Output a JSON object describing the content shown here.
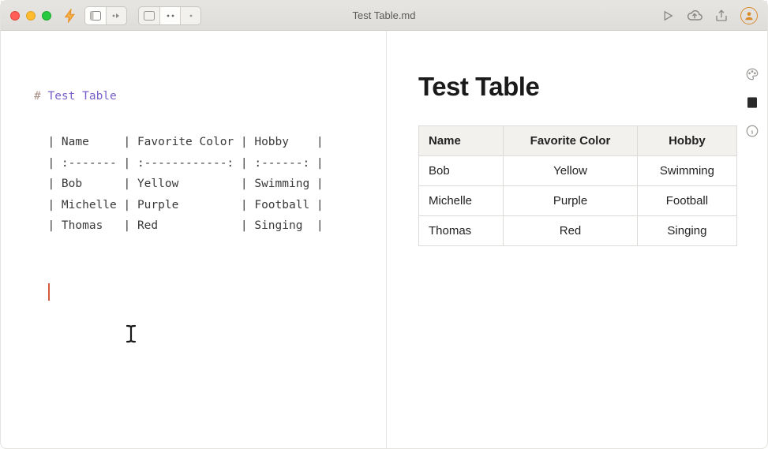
{
  "titlebar": {
    "filename": "Test Table.md"
  },
  "editor": {
    "heading_marker": "# ",
    "heading_text": "Test Table",
    "lines": {
      "header": "  | Name     | Favorite Color | Hobby    |",
      "sep": "  | :------- | :------------: | :------: |",
      "row1": "  | Bob      | Yellow         | Swimming |",
      "row2": "  | Michelle | Purple         | Football |",
      "row3": "  | Thomas   | Red            | Singing  |"
    }
  },
  "preview": {
    "title": "Test Table",
    "table": {
      "headers": [
        "Name",
        "Favorite Color",
        "Hobby"
      ],
      "rows": [
        [
          "Bob",
          "Yellow",
          "Swimming"
        ],
        [
          "Michelle",
          "Purple",
          "Football"
        ],
        [
          "Thomas",
          "Red",
          "Singing"
        ]
      ]
    }
  },
  "chart_data": {
    "type": "table",
    "title": "Test Table",
    "headers": [
      "Name",
      "Favorite Color",
      "Hobby"
    ],
    "rows": [
      [
        "Bob",
        "Yellow",
        "Swimming"
      ],
      [
        "Michelle",
        "Purple",
        "Football"
      ],
      [
        "Thomas",
        "Red",
        "Singing"
      ]
    ]
  }
}
